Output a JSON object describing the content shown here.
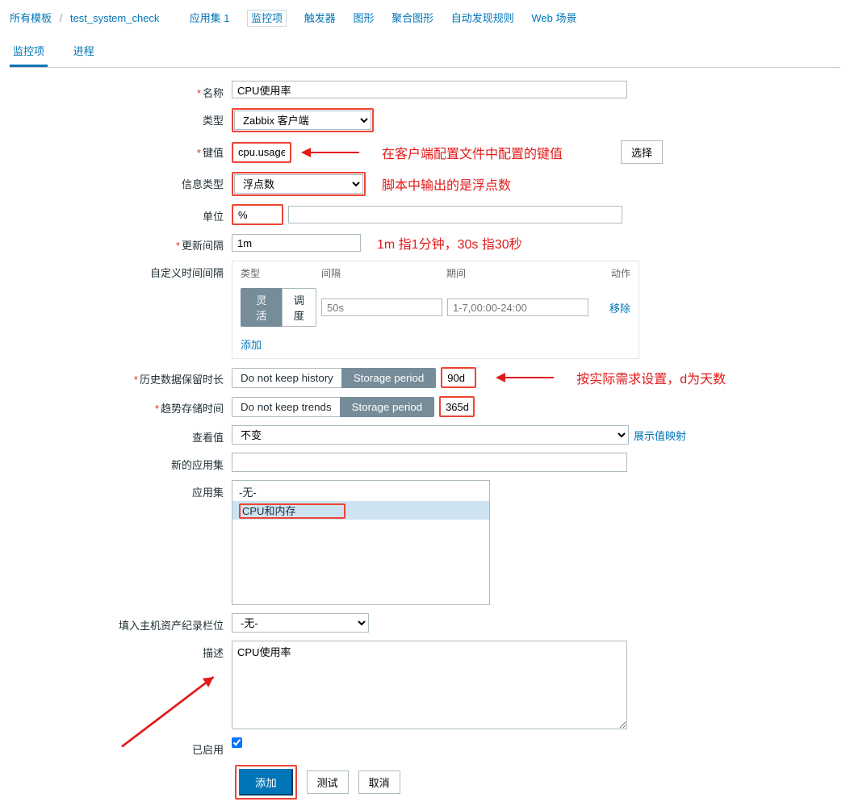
{
  "breadcrumb": {
    "all_templates": "所有模板",
    "template_name": "test_system_check"
  },
  "top_tabs": {
    "apps": "应用集 1",
    "items": "监控项",
    "triggers": "触发器",
    "graphs": "图形",
    "screens": "聚合图形",
    "discovery": "自动发现规则",
    "web": "Web 场景"
  },
  "sub_tabs": {
    "item": "监控项",
    "process": "进程"
  },
  "labels": {
    "name": "名称",
    "type": "类型",
    "key": "键值",
    "info_type": "信息类型",
    "unit": "单位",
    "update_interval": "更新间隔",
    "custom_interval": "自定义时间间隔",
    "history": "历史数据保留时长",
    "trends": "趋势存储时间",
    "show_value": "查看值",
    "new_app": "新的应用集",
    "apps": "应用集",
    "inventory": "填入主机资产纪录栏位",
    "description": "描述",
    "enabled": "已启用",
    "select_btn": "选择"
  },
  "values": {
    "name": "CPU使用率",
    "type": "Zabbix 客户端",
    "key": "cpu.usage",
    "info_type": "浮点数",
    "unit": "%",
    "update_interval": "1m",
    "history_val": "90d",
    "trends_val": "365d",
    "show_value": "不变",
    "show_value_link": "展示值映射",
    "inventory": "-无-",
    "description": "CPU使用率"
  },
  "interval": {
    "hdr_type": "类型",
    "hdr_interval": "间隔",
    "hdr_period": "期间",
    "hdr_action": "动作",
    "seg_flex": "灵活",
    "seg_sched": "调度",
    "ph_interval": "50s",
    "ph_period": "1-7,00:00-24:00",
    "remove": "移除",
    "add": "添加"
  },
  "seg_buttons": {
    "no_history": "Do not keep history",
    "storage_period": "Storage period",
    "no_trends": "Do not keep trends"
  },
  "applist": {
    "none": "-无-",
    "cpu_mem": "CPU和内存"
  },
  "buttons": {
    "add": "添加",
    "test": "测试",
    "cancel": "取消"
  },
  "annotations": {
    "key": "在客户端配置文件中配置的键值",
    "info_type": "脚本中输出的是浮点数",
    "interval": "1m 指1分钟，30s 指30秒",
    "storage": "按实际需求设置，d为天数"
  }
}
